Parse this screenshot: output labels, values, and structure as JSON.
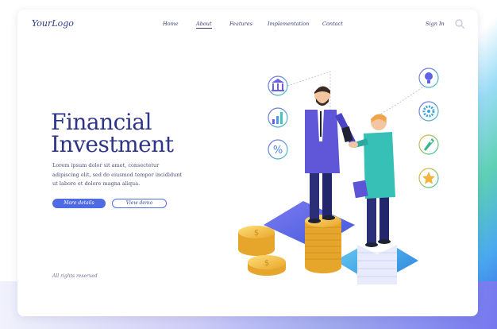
{
  "header": {
    "logo": "YourLogo",
    "nav": [
      {
        "label": "Home",
        "active": false
      },
      {
        "label": "About",
        "active": true
      },
      {
        "label": "Features",
        "active": false
      },
      {
        "label": "Implementation",
        "active": false
      },
      {
        "label": "Contact",
        "active": false
      }
    ],
    "sign_in": "Sign In",
    "search_icon": "search-icon"
  },
  "hero": {
    "title_line1": "Financial",
    "title_line2": "Investment",
    "description": "Lorem ipsum dolor sit amet, consectetur adipiscing elit, sed do eiusmod tempor incididunt ut labore et dolore magna aliqua.",
    "primary_button": "More details",
    "secondary_button": "View demo"
  },
  "footer": {
    "copyright": "All rights reserved"
  },
  "colors": {
    "primary": "#4e6be3",
    "title": "#2e3488"
  },
  "illustration": {
    "icons": [
      "bank-icon",
      "bar-chart-icon",
      "percent-icon",
      "lightbulb-icon",
      "gear-icon",
      "rocket-icon",
      "star-icon"
    ]
  }
}
